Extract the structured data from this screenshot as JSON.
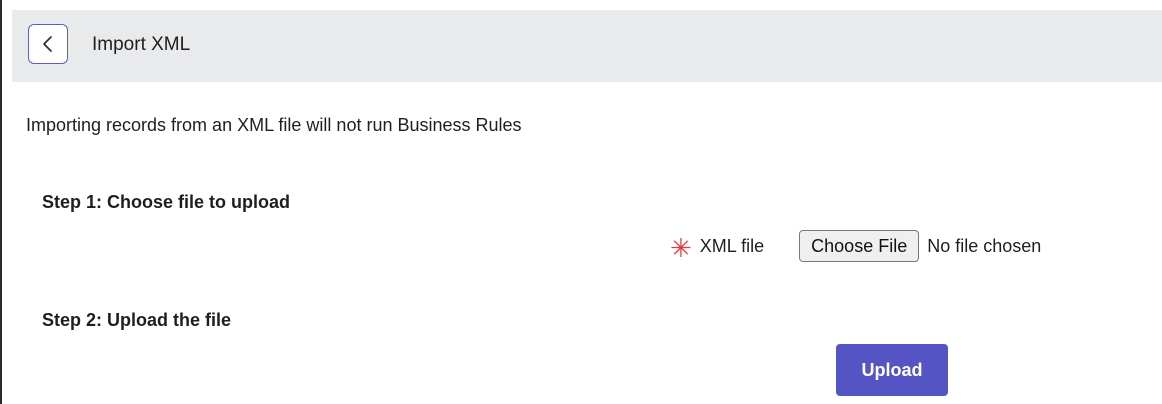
{
  "header": {
    "back_icon": "chevron-left-icon",
    "title": "Import XML"
  },
  "notice": "Importing records from an XML file will not run Business Rules",
  "step1": {
    "heading": "Step 1: Choose file to upload",
    "field": {
      "required_icon": "asterisk-icon",
      "label": "XML file",
      "choose_button_label": "Choose File",
      "status": "No file chosen"
    }
  },
  "step2": {
    "heading": "Step 2: Upload the file",
    "upload_button_label": "Upload"
  },
  "colors": {
    "accent": "#5454c4",
    "required": "#e0393e",
    "header_bg": "#e9eaec"
  }
}
